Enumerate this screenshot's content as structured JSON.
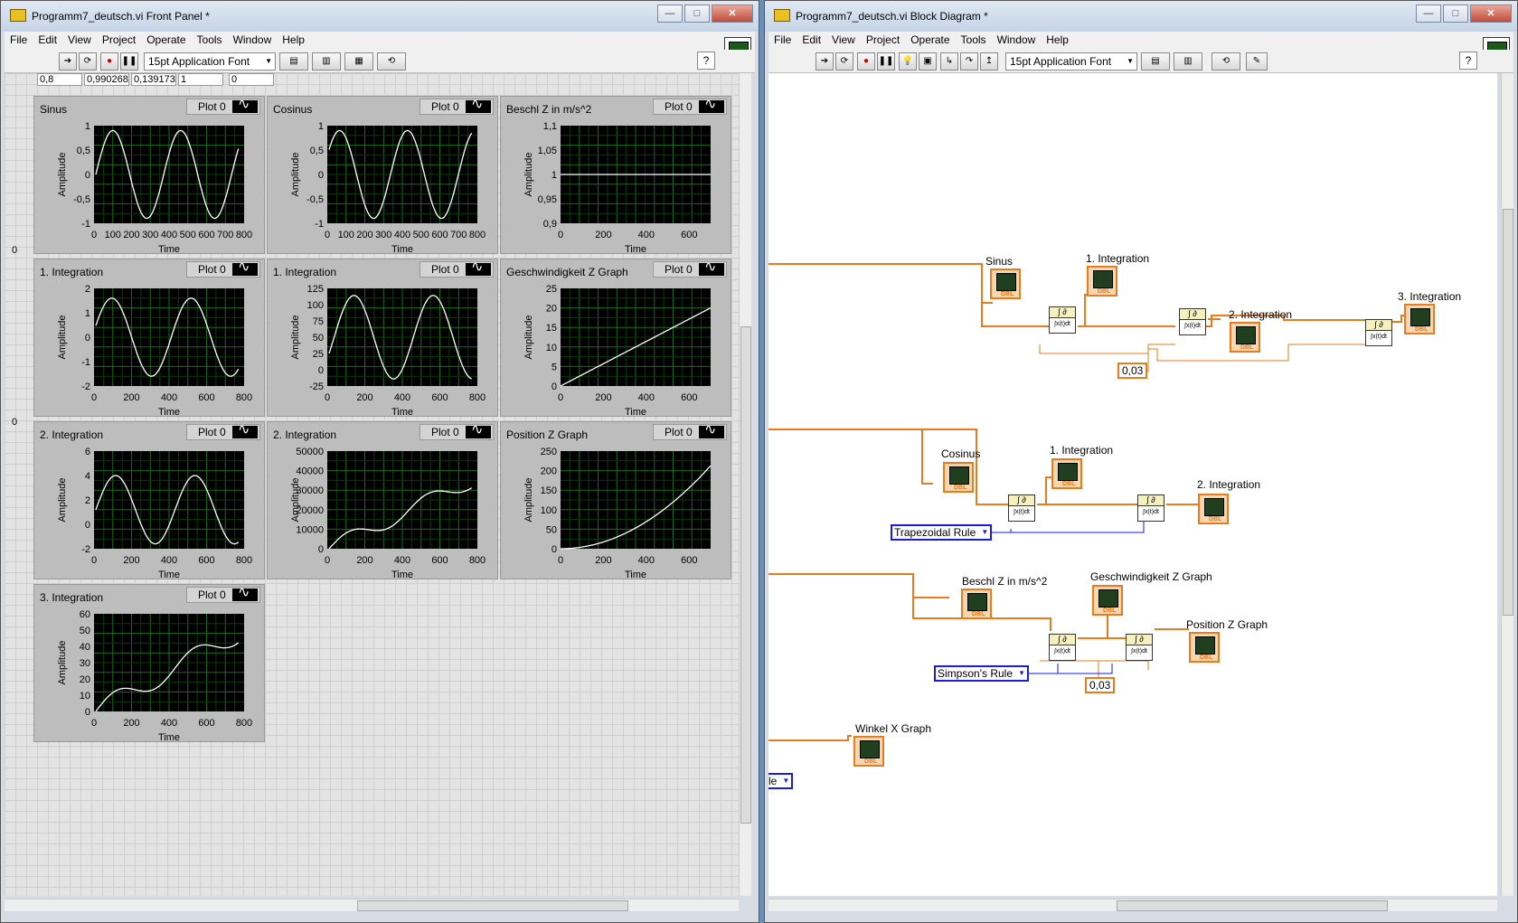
{
  "front_panel": {
    "title": "Programm7_deutsch.vi Front Panel *",
    "menu": [
      "File",
      "Edit",
      "View",
      "Project",
      "Operate",
      "Tools",
      "Window",
      "Help"
    ],
    "font": "15pt Application Font",
    "numbers": [
      "0,8",
      "0,990268",
      "0,139173",
      "1",
      "0"
    ],
    "side_zero": "0",
    "graphs": [
      {
        "label": "Sinus",
        "legend": "Plot 0",
        "ylabel": "Amplitude",
        "xlabel": "Time",
        "yticks": [
          "1",
          "0,5",
          "0",
          "-0,5",
          "-1"
        ],
        "xticks": [
          "0",
          "100",
          "200",
          "300",
          "400",
          "500",
          "600",
          "700",
          "800"
        ],
        "curve": "sin"
      },
      {
        "label": "Cosinus",
        "legend": "Plot 0",
        "ylabel": "Amplitude",
        "xlabel": "Time",
        "yticks": [
          "1",
          "0,5",
          "0",
          "-0,5",
          "-1"
        ],
        "xticks": [
          "0",
          "100",
          "200",
          "300",
          "400",
          "500",
          "600",
          "700",
          "800"
        ],
        "curve": "sin"
      },
      {
        "label": "Beschl Z in m/s^2",
        "legend": "Plot 0",
        "ylabel": "Amplitude",
        "xlabel": "Time",
        "yticks": [
          "1,1",
          "1,05",
          "1",
          "0,95",
          "0,9"
        ],
        "xticks": [
          "0",
          "200",
          "400",
          "600"
        ],
        "curve": "flat"
      },
      {
        "label": "1. Integration",
        "legend": "Plot 0",
        "ylabel": "Amplitude",
        "xlabel": "Time",
        "yticks": [
          "2",
          "1",
          "0",
          "-1",
          "-2"
        ],
        "xticks": [
          "0",
          "200",
          "400",
          "600",
          "800"
        ],
        "curve": "sin2"
      },
      {
        "label": "1. Integration",
        "legend": "Plot 0",
        "ylabel": "Amplitude",
        "xlabel": "Time",
        "yticks": [
          "125",
          "100",
          "75",
          "50",
          "25",
          "0",
          "-25"
        ],
        "xticks": [
          "0",
          "200",
          "400",
          "600",
          "800"
        ],
        "curve": "sin3"
      },
      {
        "label": "Geschwindigkeit Z Graph",
        "legend": "Plot 0",
        "ylabel": "Amplitude",
        "xlabel": "Time",
        "yticks": [
          "25",
          "20",
          "15",
          "10",
          "5",
          "0"
        ],
        "xticks": [
          "0",
          "200",
          "400",
          "600"
        ],
        "curve": "line"
      },
      {
        "label": "2. Integration",
        "legend": "Plot 0",
        "ylabel": "Amplitude",
        "xlabel": "Time",
        "yticks": [
          "6",
          "4",
          "2",
          "0",
          "-2"
        ],
        "xticks": [
          "0",
          "200",
          "400",
          "600",
          "800"
        ],
        "curve": "sin4"
      },
      {
        "label": "2. Integration",
        "legend": "Plot 0",
        "ylabel": "Amplitude",
        "xlabel": "Time",
        "yticks": [
          "50000",
          "40000",
          "30000",
          "20000",
          "10000",
          "0"
        ],
        "xticks": [
          "0",
          "200",
          "400",
          "600",
          "800"
        ],
        "curve": "steps"
      },
      {
        "label": "Position Z Graph",
        "legend": "Plot 0",
        "ylabel": "Amplitude",
        "xlabel": "Time",
        "yticks": [
          "250",
          "200",
          "150",
          "100",
          "50",
          "0"
        ],
        "xticks": [
          "0",
          "200",
          "400",
          "600"
        ],
        "curve": "parab"
      },
      {
        "label": "3. Integration",
        "legend": "Plot 0",
        "ylabel": "Amplitude",
        "xlabel": "Time",
        "yticks": [
          "60",
          "50",
          "40",
          "30",
          "20",
          "10",
          "0"
        ],
        "xticks": [
          "0",
          "200",
          "400",
          "600",
          "800"
        ],
        "curve": "steps2"
      }
    ]
  },
  "block_diagram": {
    "title": "Programm7_deutsch.vi Block Diagram *",
    "menu": [
      "File",
      "Edit",
      "View",
      "Project",
      "Operate",
      "Tools",
      "Window",
      "Help"
    ],
    "font": "15pt Application Font",
    "labels": {
      "sinus": "Sinus",
      "int1a": "1. Integration",
      "int2a": "2. Integration",
      "int3a": "3. Integration",
      "cosinus": "Cosinus",
      "int1b": "1. Integration",
      "int2b": "2. Integration",
      "beschl": "Beschl Z in m/s^2",
      "geschw": "Geschwindigkeit Z Graph",
      "position": "Position Z Graph",
      "winkel": "Winkel X Graph"
    },
    "constants": [
      "0,03",
      "0,03"
    ],
    "enums": [
      "Trapezoidal Rule",
      "Simpson's Rule",
      "le"
    ],
    "int_top": "∫ ∂",
    "int_bottom": "∫x(t)dt"
  }
}
